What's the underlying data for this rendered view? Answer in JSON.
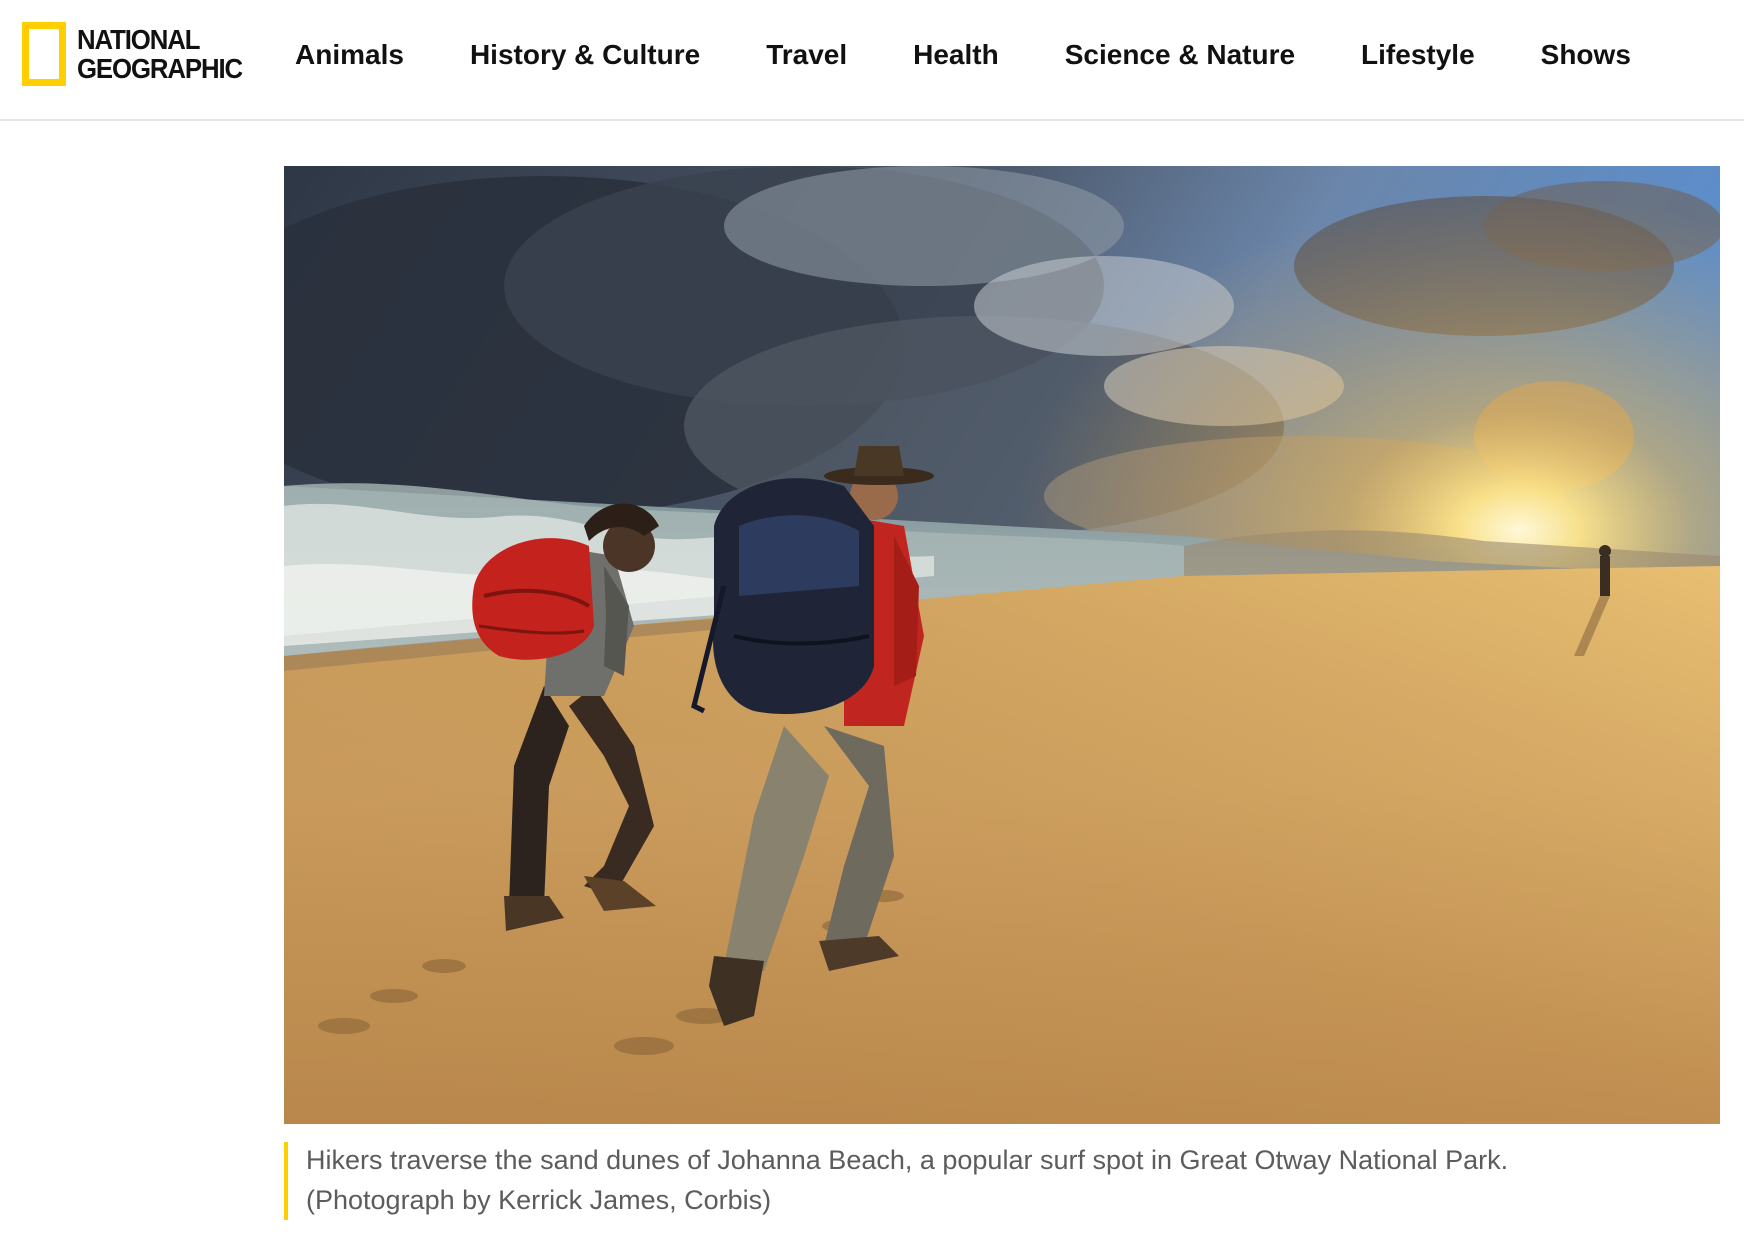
{
  "brand": {
    "name_line1": "NATIONAL",
    "name_line2": "GEOGRAPHIC",
    "accent_color": "#ffce00",
    "icon": "yellow-rectangle-logo-icon"
  },
  "nav": {
    "items": [
      {
        "label": "Animals"
      },
      {
        "label": "History & Culture"
      },
      {
        "label": "Travel"
      },
      {
        "label": "Health"
      },
      {
        "label": "Science & Nature"
      },
      {
        "label": "Lifestyle"
      },
      {
        "label": "Shows"
      }
    ]
  },
  "figure": {
    "caption": "Hikers traverse the sand dunes of Johanna Beach, a popular surf spot in Great Otway National Park.",
    "credit": "(Photograph by Kerrick James, Corbis)"
  }
}
